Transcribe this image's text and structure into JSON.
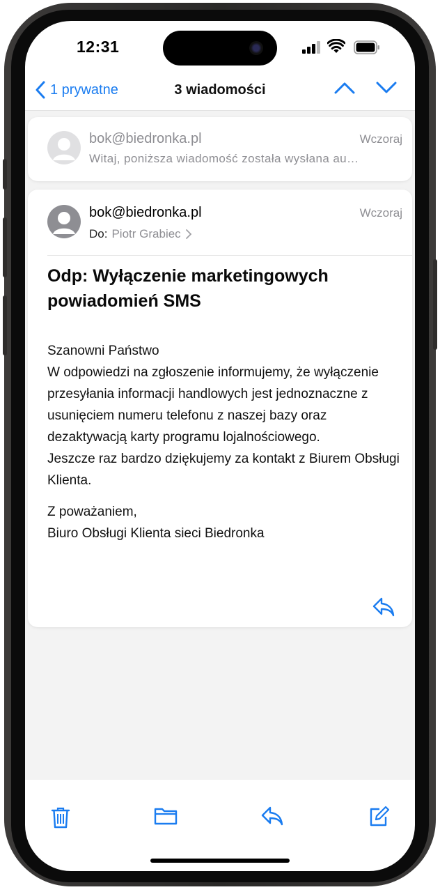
{
  "status": {
    "time": "12:31"
  },
  "nav": {
    "back_label": "1 prywatne",
    "title": "3 wiadomości"
  },
  "messages": [
    {
      "sender": "bok@biedronka.pl",
      "date": "Wczoraj",
      "preview": "Witaj, poniższa wiadomość została wysłana au…"
    },
    {
      "sender": "bok@biedronka.pl",
      "date": "Wczoraj",
      "to_label": "Do:",
      "to_name": "Piotr Grabiec",
      "subject": "Odp: Wyłączenie marketingowych powiadomień SMS",
      "body": {
        "greeting": "Szanowni Państwo",
        "p1": "W odpowiedzi na zgłoszenie informujemy, że wyłączenie przesyłania informacji handlowych jest jednoznaczne z usunięciem numeru telefonu z naszej bazy oraz dezaktywacją karty programu lojalnościowego.",
        "p2": "Jeszcze raz bardzo dziękujemy za kontakt z Biurem Obsługi Klienta.",
        "closing": "Z poważaniem,",
        "signature": "Biuro Obsługi Klienta sieci Biedronka"
      }
    }
  ],
  "icons": {
    "back": "chevron-left-icon",
    "up": "chevron-up-icon",
    "down": "chevron-down-icon",
    "reply": "reply-icon",
    "trash": "trash-icon",
    "folder": "folder-icon",
    "compose": "compose-icon"
  },
  "colors": {
    "accent": "#1a7cf0",
    "secondary_text": "#8e8e93"
  }
}
